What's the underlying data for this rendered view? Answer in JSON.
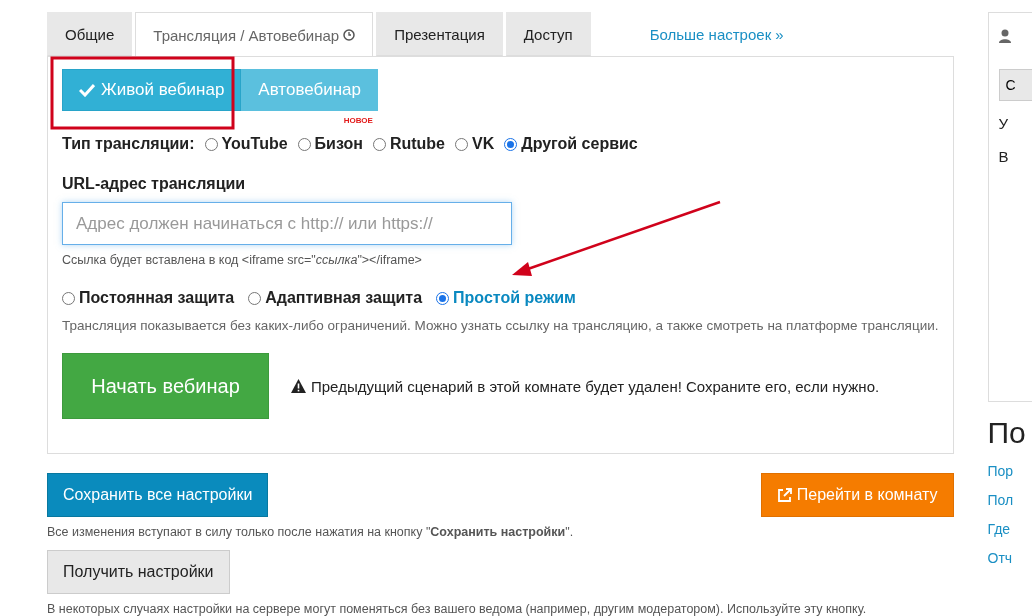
{
  "tabs": [
    {
      "label": "Общие",
      "selected": false,
      "clock": false
    },
    {
      "label": "Трансляция / Автовебинар",
      "selected": true,
      "clock": true
    },
    {
      "label": "Презентация",
      "selected": false,
      "clock": false
    },
    {
      "label": "Доступ",
      "selected": false,
      "clock": false
    }
  ],
  "more_link": "Больше настроек »",
  "mode_buttons": [
    {
      "label": "Живой вебинар",
      "selected": true
    },
    {
      "label": "Автовебинар",
      "selected": false
    }
  ],
  "stream_type": {
    "label": "Тип трансляции:",
    "options": [
      {
        "label": "YouTube",
        "selected": false
      },
      {
        "label": "Бизон",
        "selected": false,
        "badge": "НОВОЕ"
      },
      {
        "label": "Rutube",
        "selected": false
      },
      {
        "label": "VK",
        "selected": false
      },
      {
        "label": "Другой сервис",
        "selected": true
      }
    ]
  },
  "url": {
    "label": "URL-адрес трансляции",
    "placeholder": "Адрес должен начинаться с http:// или https://",
    "hint": "Ссылка будет вставлена в код <iframe src=\"*ссылка*\"></iframe>"
  },
  "protection": {
    "options": [
      {
        "label": "Постоянная защита",
        "selected": false
      },
      {
        "label": "Адаптивная защита",
        "selected": false
      },
      {
        "label": "Простой режим",
        "selected": true
      }
    ],
    "description": "Трансляция показывается без каких-либо ограничений. Можно узнать ссылку на трансляцию, а также смотреть на платформе трансляции."
  },
  "start_button": "Начать вебинар",
  "warning": "Предыдущий сценарий в этой комнате будет удален! Сохраните его, если нужно.",
  "save_button": "Сохранить все настройки",
  "room_button": "Перейти в комнату",
  "save_note": "Все изменения вступают в силу только после нажатия на кнопку \"**Сохранить настройки**\".",
  "get_button": "Получить настройки",
  "get_note": "В некоторых случаях настройки на сервере могут поменяться без вашего ведома (например, другим модератором). Используйте эту кнопку.",
  "side": {
    "button": "С",
    "text_1": "У",
    "text_2": "В",
    "heading": "По",
    "links": [
      "Пор",
      "Пол",
      "Где",
      "Отч"
    ]
  }
}
